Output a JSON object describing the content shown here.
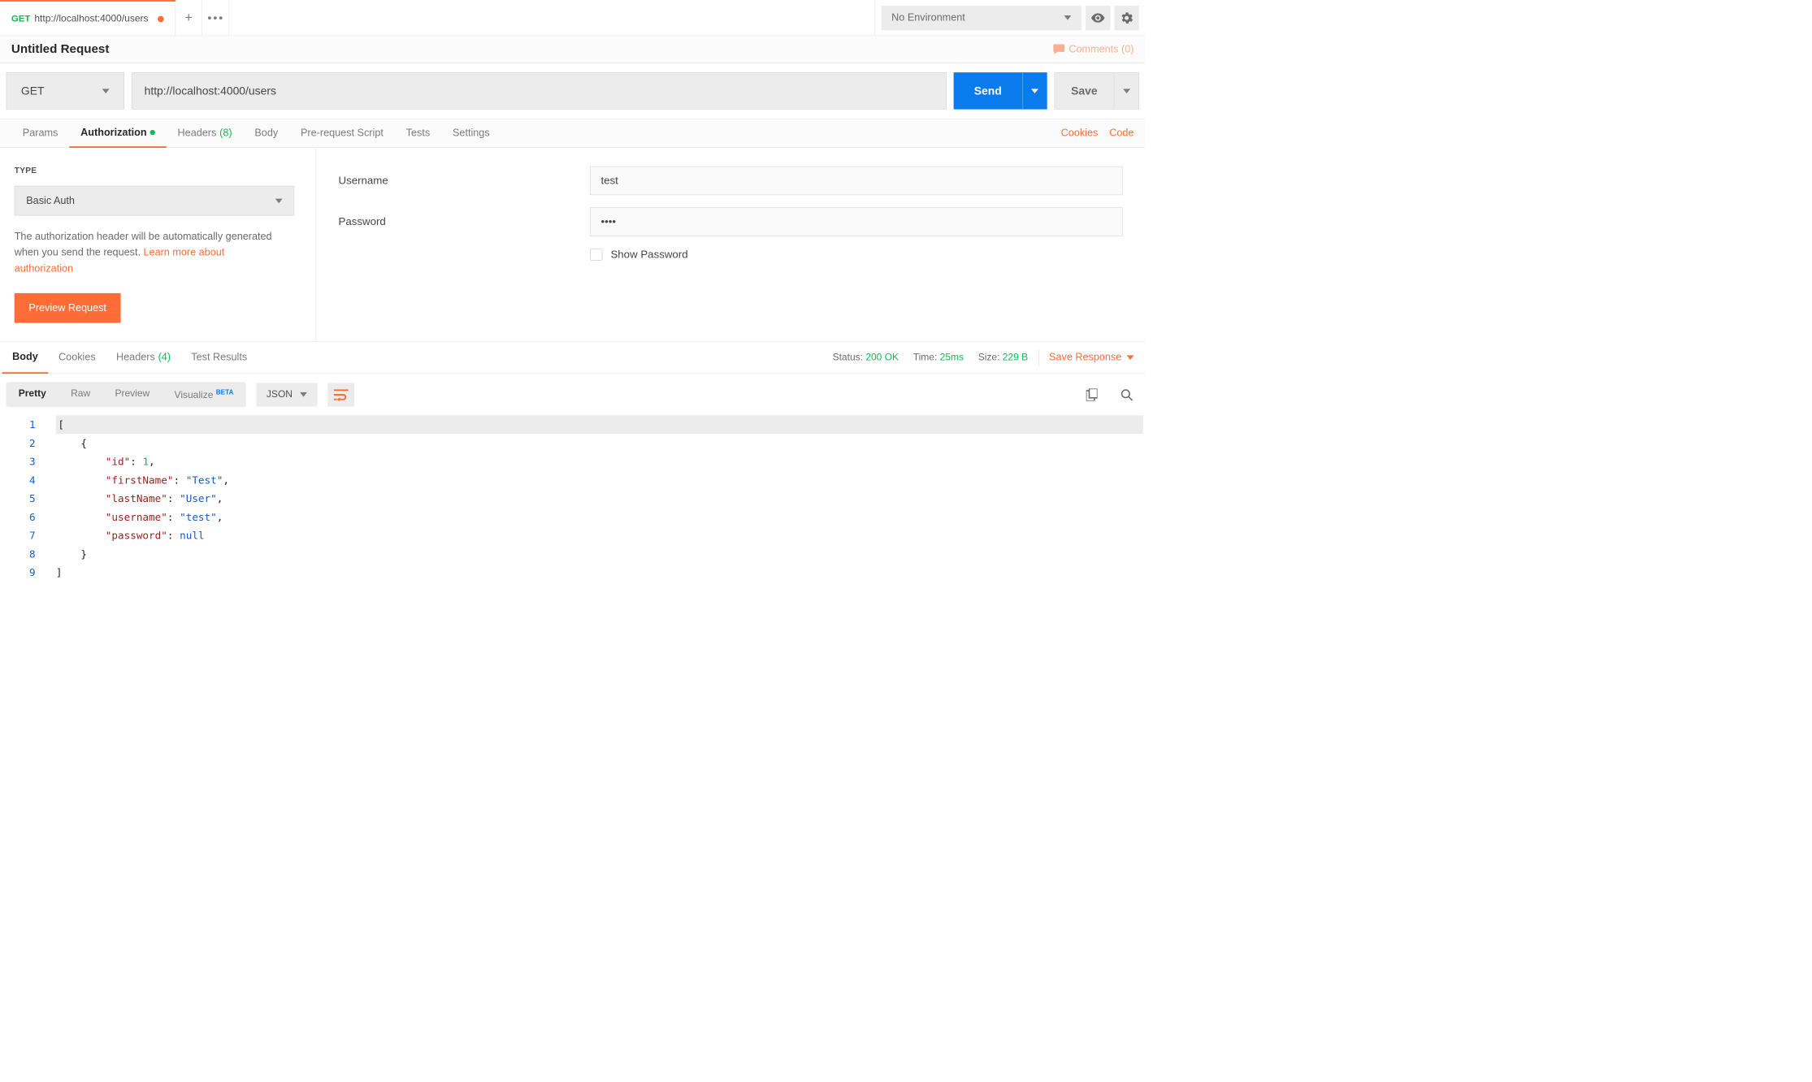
{
  "topbar": {
    "tab": {
      "method": "GET",
      "title": "http://localhost:4000/users"
    },
    "env_label": "No Environment"
  },
  "titlebar": {
    "title": "Untitled Request",
    "comments_label": "Comments (0)"
  },
  "request": {
    "method": "GET",
    "url": "http://localhost:4000/users",
    "send_label": "Send",
    "save_label": "Save"
  },
  "reqtabs": {
    "params": "Params",
    "auth": "Authorization",
    "headers": "Headers",
    "headers_count": "(8)",
    "body": "Body",
    "prereq": "Pre-request Script",
    "tests": "Tests",
    "settings": "Settings",
    "cookies": "Cookies",
    "code": "Code"
  },
  "auth": {
    "type_label": "TYPE",
    "type_value": "Basic Auth",
    "help_text": "The authorization header will be automatically generated when you send the request. ",
    "help_link": "Learn more about authorization",
    "preview_btn": "Preview Request",
    "username_label": "Username",
    "username_value": "test",
    "password_label": "Password",
    "password_value": "••••",
    "show_pw_label": "Show Password"
  },
  "resptabs": {
    "body": "Body",
    "cookies": "Cookies",
    "headers": "Headers",
    "headers_count": "(4)",
    "tests": "Test Results",
    "status_label": "Status:",
    "status_value": "200 OK",
    "time_label": "Time:",
    "time_value": "25ms",
    "size_label": "Size:",
    "size_value": "229 B",
    "save_resp": "Save Response"
  },
  "viewctrl": {
    "pretty": "Pretty",
    "raw": "Raw",
    "preview": "Preview",
    "visualize": "Visualize",
    "beta": "BETA",
    "format": "JSON"
  },
  "response_json": [
    {
      "id": 1,
      "firstName": "Test",
      "lastName": "User",
      "username": "test",
      "password": null
    }
  ],
  "code_lines": {
    "l1": "[",
    "l2": "    {",
    "l2b": "{",
    "l3_k": "\"id\"",
    "l3_v": "1",
    "l4_k": "\"firstName\"",
    "l4_v": "\"Test\"",
    "l5_k": "\"lastName\"",
    "l5_v": "\"User\"",
    "l6_k": "\"username\"",
    "l6_v": "\"test\"",
    "l7_k": "\"password\"",
    "l7_v": "null",
    "l8": "    }",
    "l8b": "}",
    "l9": "]",
    "ln1": "1",
    "ln2": "2",
    "ln3": "3",
    "ln4": "4",
    "ln5": "5",
    "ln6": "6",
    "ln7": "7",
    "ln8": "8",
    "ln9": "9"
  }
}
